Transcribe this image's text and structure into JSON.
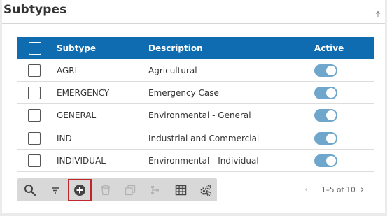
{
  "panel": {
    "title": "Subtypes"
  },
  "table": {
    "headers": {
      "subtype": "Subtype",
      "description": "Description",
      "active": "Active"
    },
    "rows": [
      {
        "subtype": "AGRI",
        "description": "Agricultural",
        "active": true
      },
      {
        "subtype": "EMERGENCY",
        "description": "Emergency Case",
        "active": true
      },
      {
        "subtype": "GENERAL",
        "description": "Environmental - General",
        "active": true
      },
      {
        "subtype": "IND",
        "description": "Industrial and Commercial",
        "active": true
      },
      {
        "subtype": "INDIVIDUAL",
        "description": "Environmental - Individual",
        "active": true
      }
    ]
  },
  "toolbar": {
    "tools": [
      "search-icon",
      "filter-icon",
      "add-icon",
      "delete-icon",
      "copy-icon",
      "hierarchy-icon",
      "columns-icon",
      "settings-icon"
    ],
    "selected": "add-icon"
  },
  "pagination": {
    "label": "1–5 of 10"
  },
  "colors": {
    "header_bg": "#0f6cb1",
    "toggle_on": "#6ea6cc",
    "highlight": "#c0272d"
  }
}
